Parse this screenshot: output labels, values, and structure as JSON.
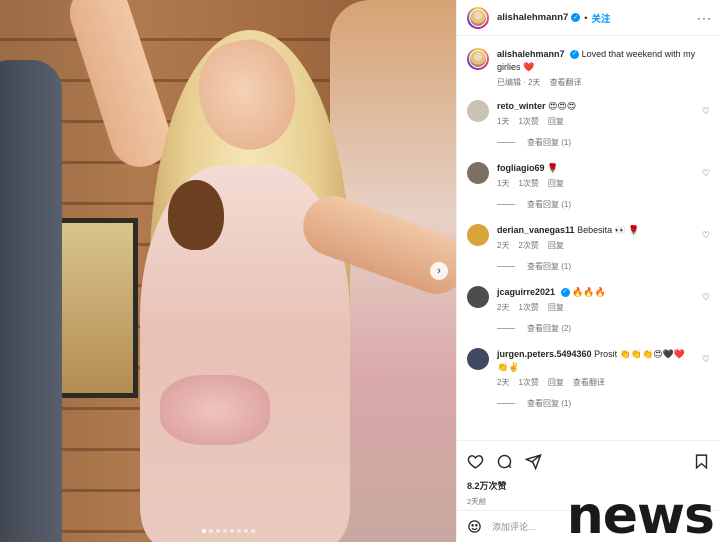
{
  "post": {
    "username": "alishalehmann7",
    "follow_label": "关注",
    "more_label": "···",
    "caption_user": "alishalehmann7",
    "caption_text": "Loved that weekend with my girlies ❤️",
    "caption_meta_edited": "已编辑 · 2天",
    "caption_meta_translate": "查看翻译"
  },
  "comments": [
    {
      "username": "reto_winter",
      "text": "😍😍😍",
      "avatar_color": "#c9c1b4",
      "time": "1天",
      "likes": "1次赞",
      "reply_label": "回复",
      "view_replies": "查看回复 (1)"
    },
    {
      "username": "fogliagio69",
      "text": "🌹",
      "avatar_color": "#7c6f64",
      "time": "1天",
      "likes": "1次赞",
      "reply_label": "回复",
      "view_replies": "查看回复 (1)"
    },
    {
      "username": "derian_vanegas11",
      "text": "Bebesita 👀 🌹",
      "avatar_color": "#d9a43a",
      "time": "2天",
      "likes": "2次赞",
      "reply_label": "回复",
      "view_replies": "查看回复 (1)"
    },
    {
      "username": "jcaguirre2021",
      "text": "🔥🔥🔥",
      "avatar_color": "#4d4d4d",
      "time": "2天",
      "likes": "1次赞",
      "reply_label": "回复",
      "view_replies": "查看回复 (2)",
      "verified": true
    },
    {
      "username": "jurgen.peters.5494360",
      "text": "Prosit 👏👏👏😍🖤❤️👏✌️",
      "avatar_color": "#3f4a62",
      "time": "2天",
      "likes": "1次赞",
      "reply_label": "回复",
      "translate_label": "查看翻译",
      "view_replies": "查看回复 (1)"
    }
  ],
  "actions": {
    "likes_count": "8.2万次赞",
    "posted_ago": "2天前",
    "comment_placeholder": "添加评论..."
  },
  "carousel": {
    "total_slides": 8,
    "active_index": 0
  },
  "watermark": "news",
  "colors": {
    "accent": "#0095f6",
    "muted": "#737373"
  }
}
